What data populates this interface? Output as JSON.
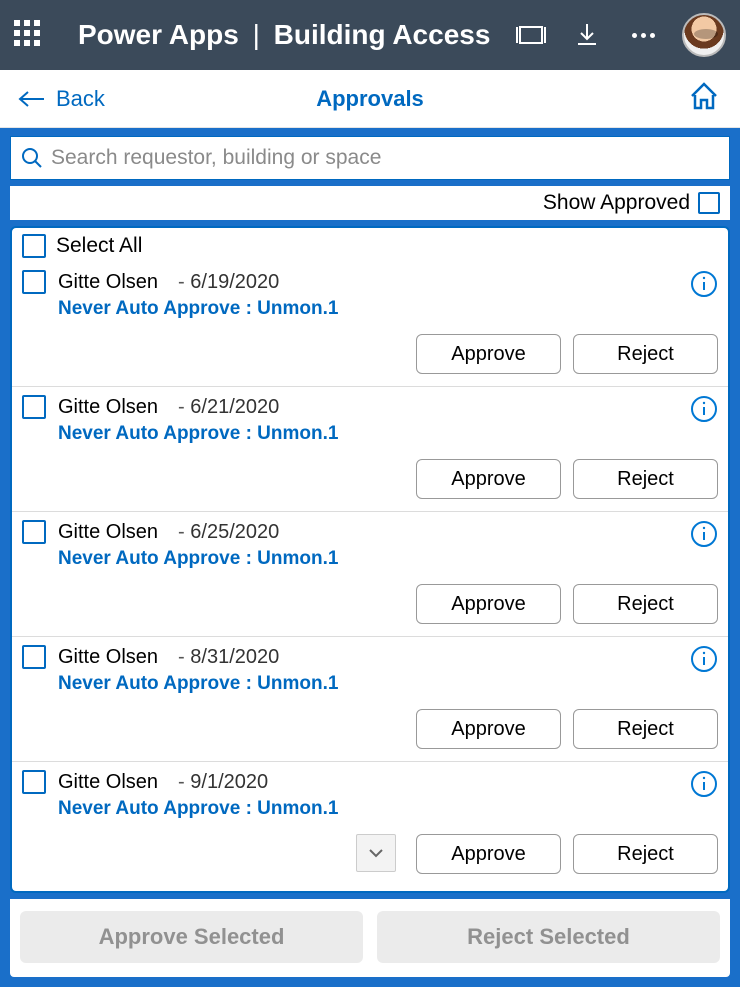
{
  "topbar": {
    "app_name": "Power Apps",
    "separator": "|",
    "page_name": "Building Access"
  },
  "subheader": {
    "back_label": "Back",
    "title": "Approvals"
  },
  "search": {
    "placeholder": "Search requestor, building or space"
  },
  "filters": {
    "show_approved_label": "Show Approved"
  },
  "list": {
    "select_all_label": "Select All",
    "rows": [
      {
        "name": "Gitte Olsen",
        "date": "6/19/2020",
        "sub": "Never Auto Approve : Unmon.1",
        "approve": "Approve",
        "reject": "Reject",
        "has_chevron": false
      },
      {
        "name": "Gitte Olsen",
        "date": "6/21/2020",
        "sub": "Never Auto Approve : Unmon.1",
        "approve": "Approve",
        "reject": "Reject",
        "has_chevron": false
      },
      {
        "name": "Gitte Olsen",
        "date": "6/25/2020",
        "sub": "Never Auto Approve : Unmon.1",
        "approve": "Approve",
        "reject": "Reject",
        "has_chevron": false
      },
      {
        "name": "Gitte Olsen",
        "date": "8/31/2020",
        "sub": "Never Auto Approve : Unmon.1",
        "approve": "Approve",
        "reject": "Reject",
        "has_chevron": false
      },
      {
        "name": "Gitte Olsen",
        "date": "9/1/2020",
        "sub": "Never Auto Approve : Unmon.1",
        "approve": "Approve",
        "reject": "Reject",
        "has_chevron": true
      }
    ]
  },
  "bottom": {
    "approve_selected": "Approve Selected",
    "reject_selected": "Reject Selected"
  }
}
